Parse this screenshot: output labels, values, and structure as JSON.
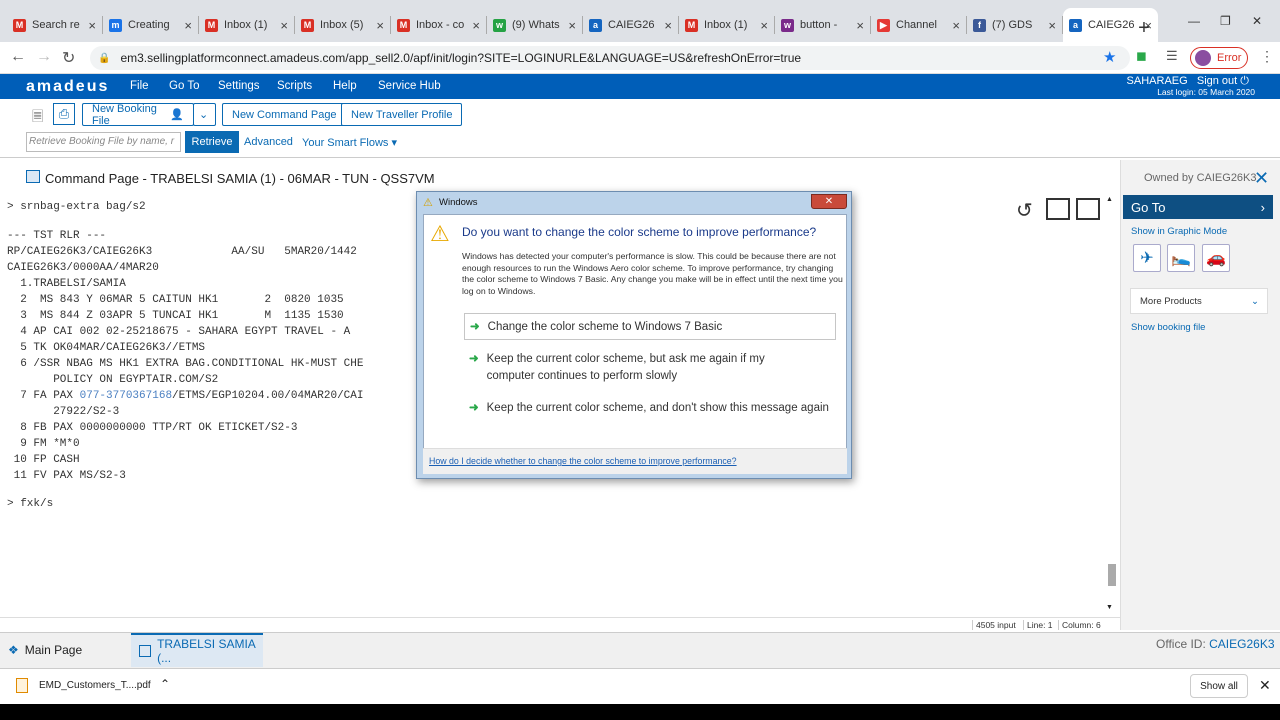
{
  "browser": {
    "tabs": [
      {
        "title": "Search re",
        "icon": "M",
        "icon_color": "#d93025"
      },
      {
        "title": "Creating",
        "icon": "m",
        "icon_color": "#1a73e8"
      },
      {
        "title": "Inbox (1)",
        "icon": "M",
        "icon_color": "#d93025"
      },
      {
        "title": "Inbox (5)",
        "icon": "M",
        "icon_color": "#d93025"
      },
      {
        "title": "Inbox - co",
        "icon": "M",
        "icon_color": "#d93025"
      },
      {
        "title": "(9) Whats",
        "icon": "w",
        "icon_color": "#25a244"
      },
      {
        "title": "CAIEG26",
        "icon": "a",
        "icon_color": "#1565c0"
      },
      {
        "title": "Inbox (1)",
        "icon": "M",
        "icon_color": "#d93025"
      },
      {
        "title": "button - ",
        "icon": "w",
        "icon_color": "#7a2a8a"
      },
      {
        "title": "Channel",
        "icon": "▶",
        "icon_color": "#e53935"
      },
      {
        "title": "(7) GDS",
        "icon": "f",
        "icon_color": "#3b5998"
      },
      {
        "title": "CAIEG26",
        "icon": "a",
        "icon_color": "#1565c0"
      }
    ],
    "new_tab": "+",
    "url": "em3.sellingplatformconnect.amadeus.com/app_sell2.0/apf/init/login?SITE=LOGINURLE&LANGUAGE=US&refreshOnError=true",
    "error_label": "Error"
  },
  "header": {
    "logo": "amadeus",
    "menu": [
      "File",
      "Go To",
      "Settings",
      "Scripts",
      "Help",
      "Service Hub"
    ],
    "user": "SAHARAEG",
    "sign_out": "Sign out",
    "last_login": "Last login: 05 March 2020"
  },
  "actions": {
    "new_booking": "New Booking File",
    "new_command": "New Command Page",
    "new_traveller": "New Traveller Profile",
    "retrieve_placeholder": "Retrieve Booking File by name, r",
    "retrieve": "Retrieve",
    "advanced": "Advanced",
    "smart_flows": "Your Smart Flows ▾"
  },
  "command_page": {
    "title": "Command Page - TRABELSI SAMIA (1) - 06MAR - TUN - QSS7VM",
    "lines": [
      "> srnbag-extra bag/s2",
      "",
      "--- TST RLR ---",
      "RP/CAIEG26K3/CAIEG26K3            AA/SU   5MAR20/1442",
      "CAIEG26K3/0000AA/4MAR20",
      "  1.TRABELSI/SAMIA",
      "  2  MS 843 Y 06MAR 5 CAITUN HK1       2  0820 1035",
      "  3  MS 844 Z 03APR 5 TUNCAI HK1       M  1135 1530",
      "  4 AP CAI 002 02-25218675 - SAHARA EGYPT TRAVEL - A",
      "  5 TK OK04MAR/CAIEG26K3//ETMS",
      "  6 /SSR NBAG MS HK1 EXTRA BAG.CONDITIONAL HK-MUST CHE",
      "       POLICY ON EGYPTAIR.COM/S2",
      "  7 FA PAX 077-3770367168/ETMS/EGP10204.00/04MAR20/CAI",
      "       27922/S2-3",
      "  8 FB PAX 0000000000 TTP/RT OK ETICKET/S2-3",
      "  9 FM *M*0",
      " 10 FP CASH",
      " 11 FV PAX MS/S2-3",
      "",
      "> fxk/s"
    ],
    "status": {
      "input": "4505 input",
      "line": "Line: 1",
      "column": "Column: 6"
    }
  },
  "right_panel": {
    "owned_by": "Owned by CAIEG26K3",
    "go_to": "Go To",
    "show_graphic": "Show in Graphic Mode",
    "more_products": "More Products",
    "show_booking": "Show booking file"
  },
  "bottom_tabs": {
    "main": "Main Page",
    "trabelsi": "TRABELSI SAMIA (...",
    "office_label": "Office ID:",
    "office_id": "CAIEG26K3"
  },
  "downloads": {
    "file": "EMD_Customers_T....pdf",
    "show_all": "Show all"
  },
  "dialog": {
    "window_title": "Windows",
    "heading": "Do you want to change the color scheme to improve performance?",
    "body": "Windows has detected your computer's performance is slow. This could be because there are not enough resources to run the Windows Aero color scheme. To improve performance, try changing the color scheme to Windows 7 Basic. Any change you make will be in effect until the next time you log on to Windows.",
    "option1": "Change the color scheme to Windows 7 Basic",
    "option2": "Keep the current color scheme, but ask me again if my computer continues to perform slowly",
    "option3": "Keep the current color scheme, and don't show this message again",
    "help_link": "How do I decide whether to change the color scheme to improve performance?"
  }
}
